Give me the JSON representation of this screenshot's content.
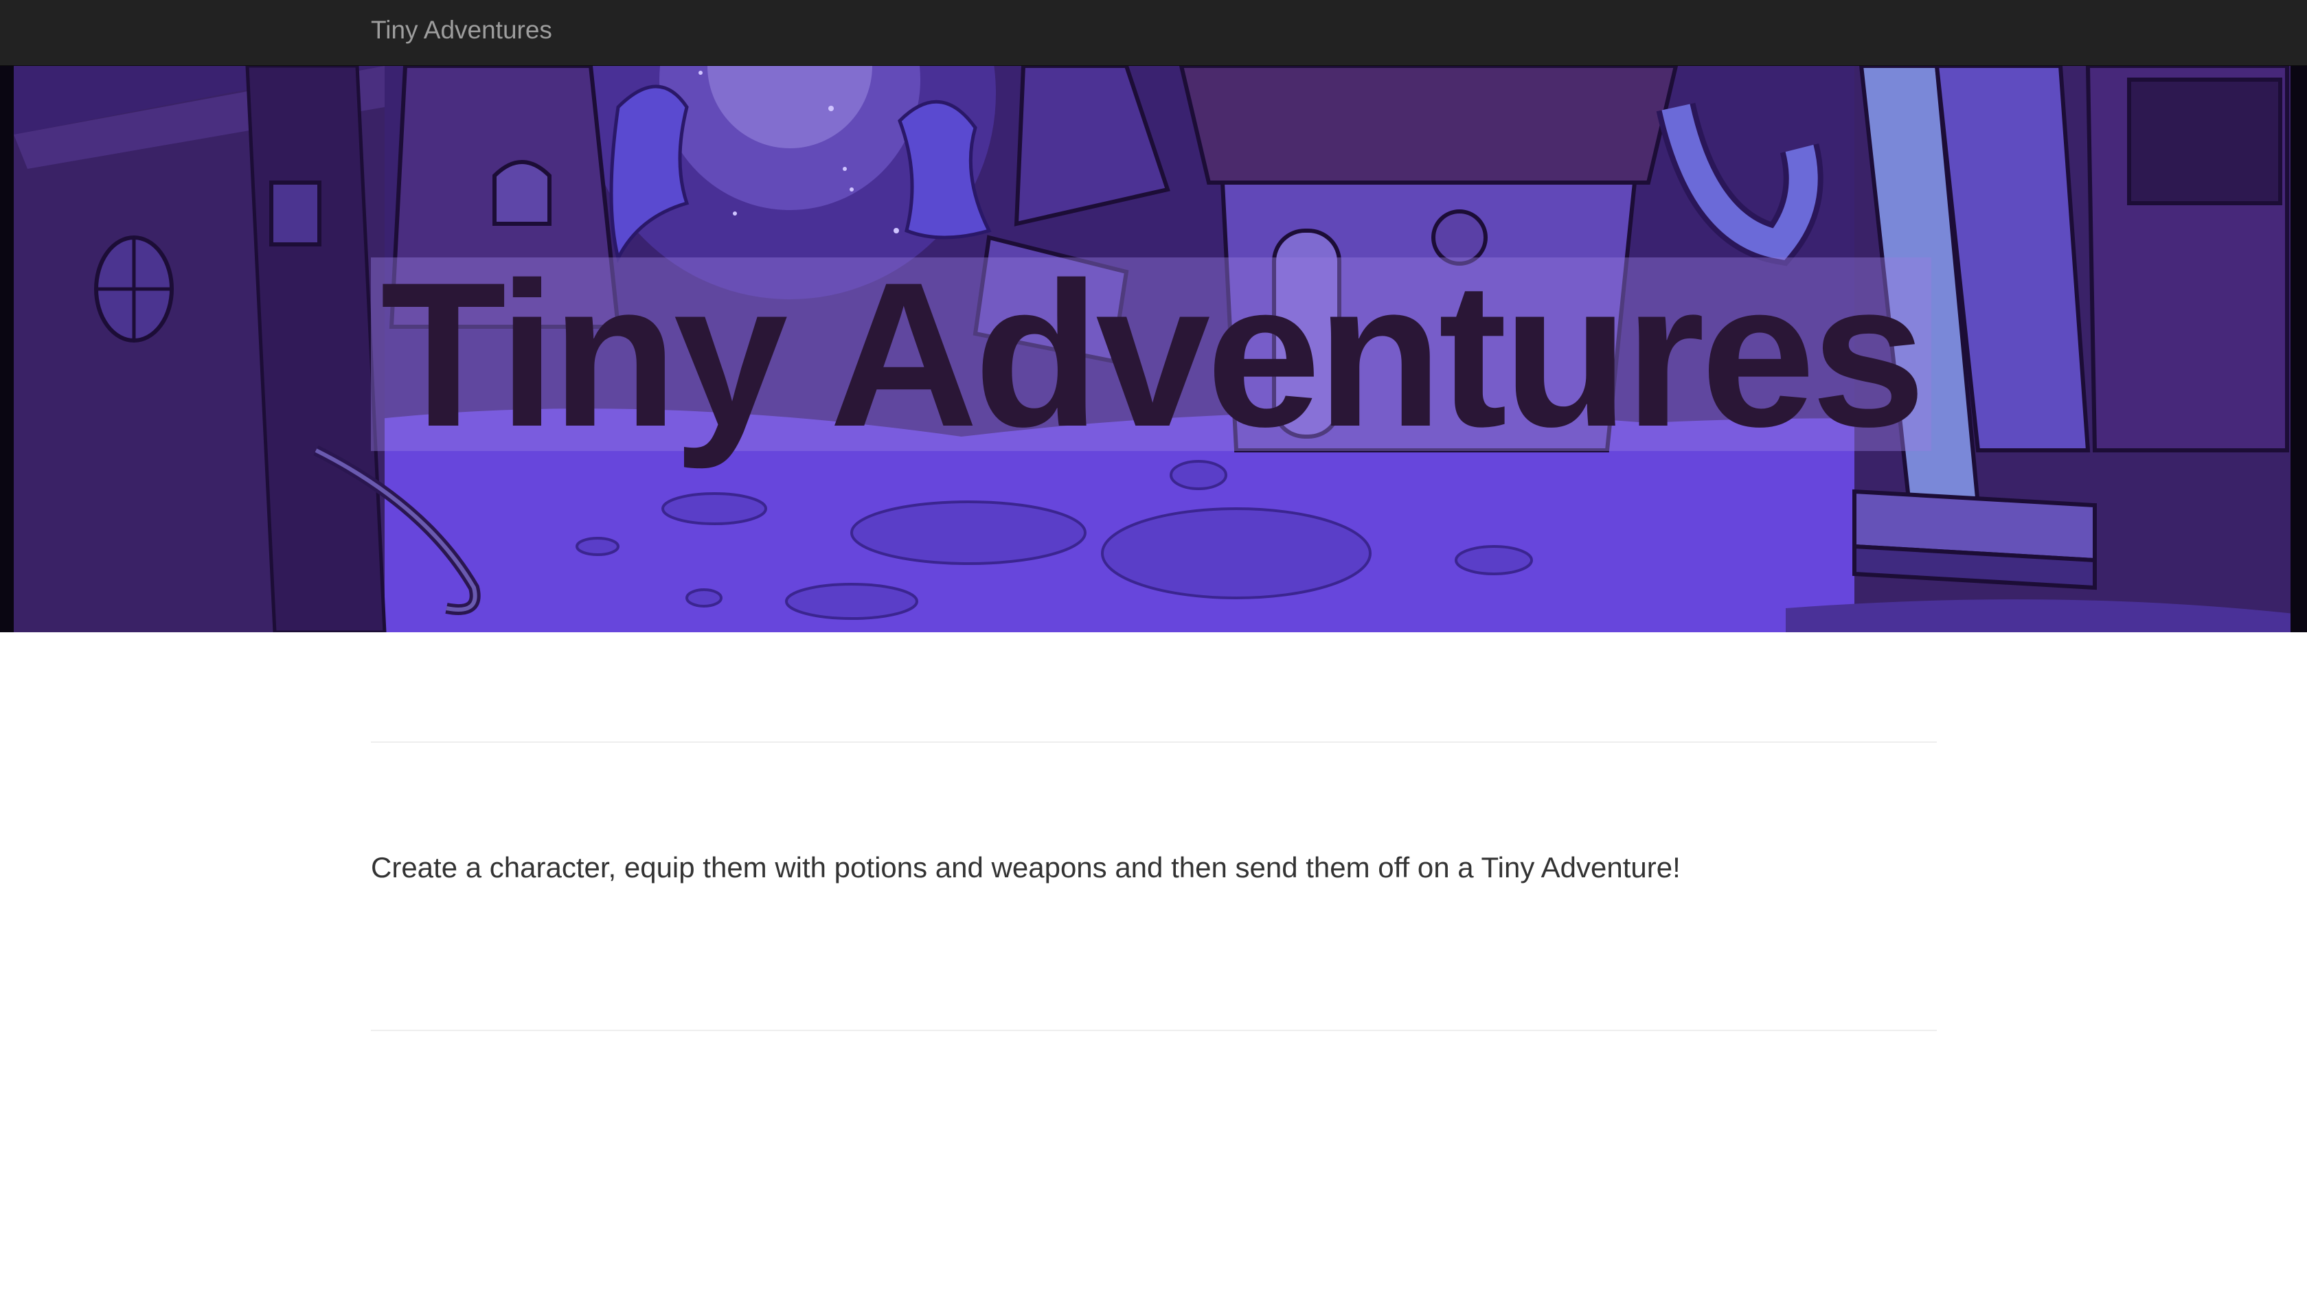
{
  "navbar": {
    "brand": "Tiny Adventures"
  },
  "hero": {
    "title": "Tiny Adventures",
    "background_image": "cartoon night village scene in purple tones",
    "colors": {
      "sky": "#3d2472",
      "ground": "#6a48e0",
      "title_text": "#2a1636"
    }
  },
  "main": {
    "tagline": "Create a character, equip them with potions and weapons and then send them off on a Tiny Adventure!"
  },
  "colors": {
    "navbar_bg": "#222222",
    "navbar_text": "#9d9d9d",
    "body_text": "#333333",
    "rule": "#eeeeee"
  }
}
